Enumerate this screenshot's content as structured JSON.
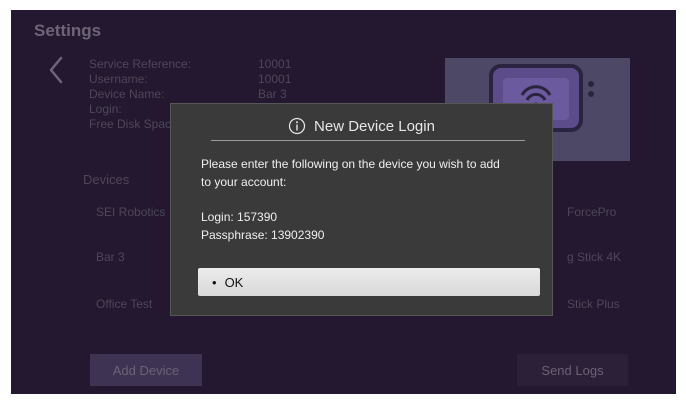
{
  "settings": {
    "title": "Settings",
    "info": [
      {
        "label": "Service Reference:",
        "value": "10001"
      },
      {
        "label": "Username:",
        "value": "10001"
      },
      {
        "label": "Device Name:",
        "value": "Bar 3"
      },
      {
        "label": "Login:",
        "value": ""
      },
      {
        "label": "Free Disk Spac",
        "value": ""
      }
    ],
    "devices_heading": "Devices",
    "devices_left": [
      "SEI Robotics",
      "Bar 3",
      "Office Test"
    ],
    "devices_right": [
      "ForcePro",
      "g Stick 4K",
      "Stick Plus"
    ],
    "add_device_label": "Add Device",
    "send_logs_label": "Send Logs"
  },
  "dialog": {
    "title": "New Device Login",
    "message_line1": "Please enter the following on the device you wish to add",
    "message_line2": "to your account:",
    "login_line": "Login: 157390",
    "passphrase_line": "Passphrase: 13902390",
    "ok_bullet": "•",
    "ok_label": "OK"
  },
  "colors": {
    "screen_bg": "#23182f",
    "dialog_bg": "#3a3a3a",
    "preview_bg": "#4d4866"
  },
  "icons": {
    "back": "chevron-left-icon",
    "dialog": "info-icon",
    "preview": "tv-wifi-icon"
  }
}
